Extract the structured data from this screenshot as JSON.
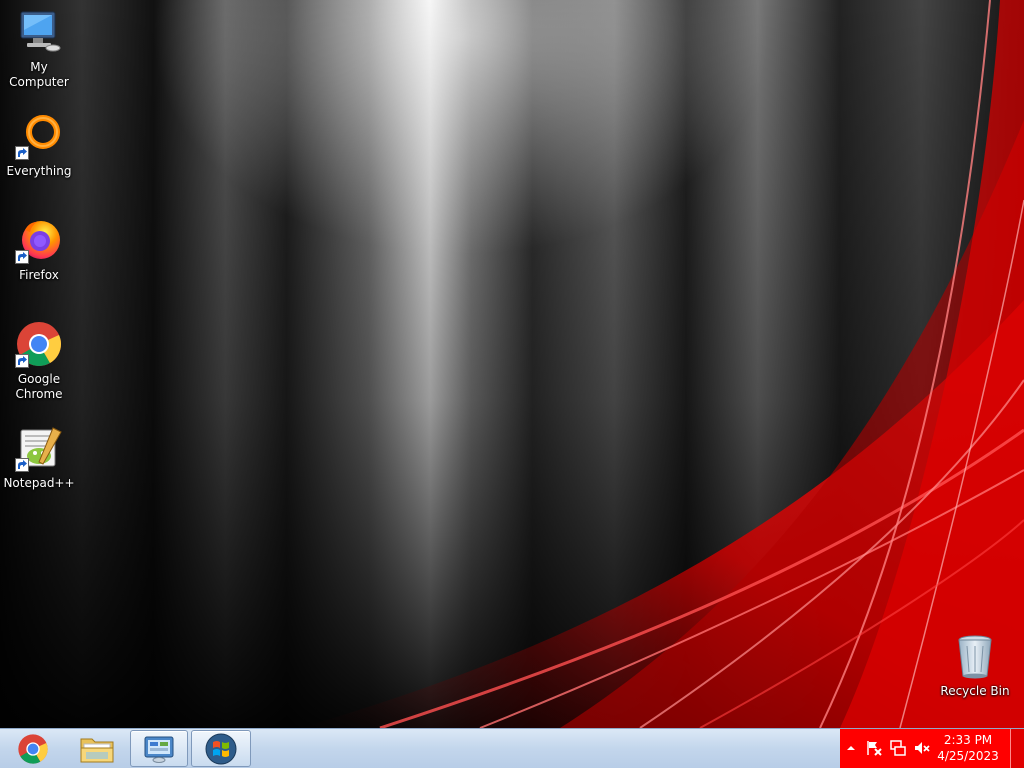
{
  "desktop": {
    "icons": [
      {
        "label": "My Computer",
        "icon": "my-computer-icon"
      },
      {
        "label": "Everything",
        "icon": "everything-icon"
      },
      {
        "label": "Firefox",
        "icon": "firefox-icon"
      },
      {
        "label": "Google Chrome",
        "icon": "chrome-icon"
      },
      {
        "label": "Notepad++",
        "icon": "notepadpp-icon"
      },
      {
        "label": "Recycle Bin",
        "icon": "recycle-bin-icon"
      }
    ]
  },
  "taskbar": {
    "buttons": [
      {
        "name": "Google Chrome",
        "icon": "chrome-icon"
      },
      {
        "name": "Windows Explorer",
        "icon": "folder-icon"
      },
      {
        "name": "Control Panel",
        "icon": "control-panel-icon"
      },
      {
        "name": "Start",
        "icon": "windows-logo-icon"
      }
    ],
    "tray": {
      "time": "2:33 PM",
      "date": "4/25/2023"
    }
  },
  "colors": {
    "tray_background": "#ff0000",
    "taskbar_background": "#c3d6ec",
    "wallpaper_accent": "#e00000"
  }
}
